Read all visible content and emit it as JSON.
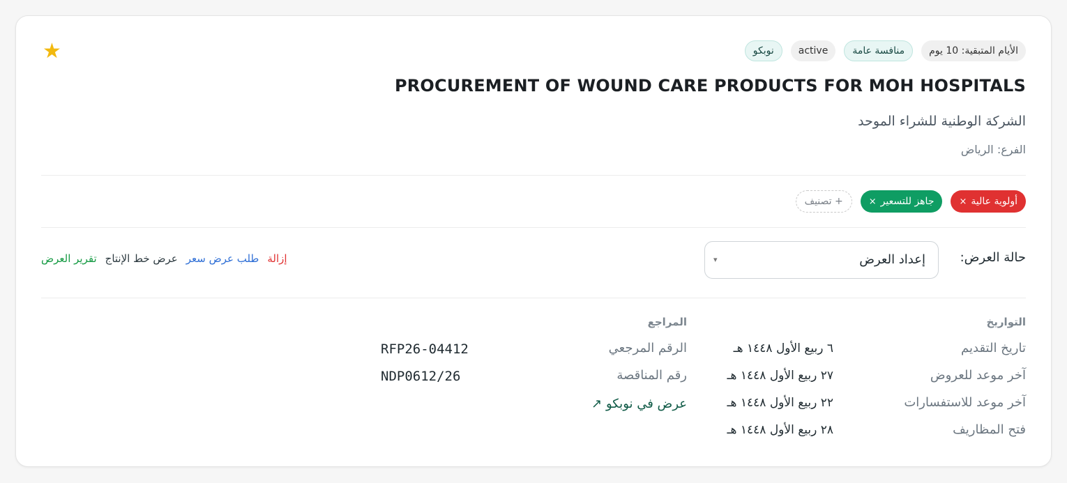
{
  "header": {
    "favorite_icon": "star-icon",
    "badges": {
      "source": "نوبكو",
      "status": "active",
      "type": "منافسة عامة",
      "days_remaining": "الأيام المتبقية: 10 يوم"
    },
    "title": "PROCUREMENT OF WOUND CARE PRODUCTS FOR MOH HOSPITALS",
    "organization": "الشركة الوطنية للشراء الموحد",
    "branch": "الفرع: الرياض"
  },
  "tags": {
    "items": [
      {
        "label": "أولوية عالية",
        "remove": "×",
        "color": "#e03131"
      },
      {
        "label": "جاهز للتسعير",
        "remove": "×",
        "color": "#0f9d63"
      }
    ],
    "add_label": "+ تصنيف"
  },
  "offer_status": {
    "label": "حالة العرض:",
    "selected": "إعداد العرض",
    "arrow": "▾"
  },
  "actions": {
    "report": "تقرير العرض",
    "production_plan": "عرض خط الإنتاج",
    "price_request": "طلب عرض سعر",
    "remove": "إزالة"
  },
  "dates": {
    "heading": "التواريخ",
    "rows": [
      {
        "label": "تاريخ التقديم",
        "value": "٦ ربيع الأول ١٤٤٨ هـ"
      },
      {
        "label": "آخر موعد للعروض",
        "value": "٢٧ ربيع الأول ١٤٤٨ هـ"
      },
      {
        "label": "آخر موعد للاستفسارات",
        "value": "٢٢ ربيع الأول ١٤٤٨ هـ"
      },
      {
        "label": "فتح المظاريف",
        "value": "٢٨ ربيع الأول ١٤٤٨ هـ"
      }
    ]
  },
  "references": {
    "heading": "المراجع",
    "rows": [
      {
        "label": "الرقم المرجعي",
        "value": "RFP26-04412"
      },
      {
        "label": "رقم المناقصة",
        "value": "NDP0612/26"
      }
    ],
    "external_link": "عرض في نوبكو ↗"
  }
}
